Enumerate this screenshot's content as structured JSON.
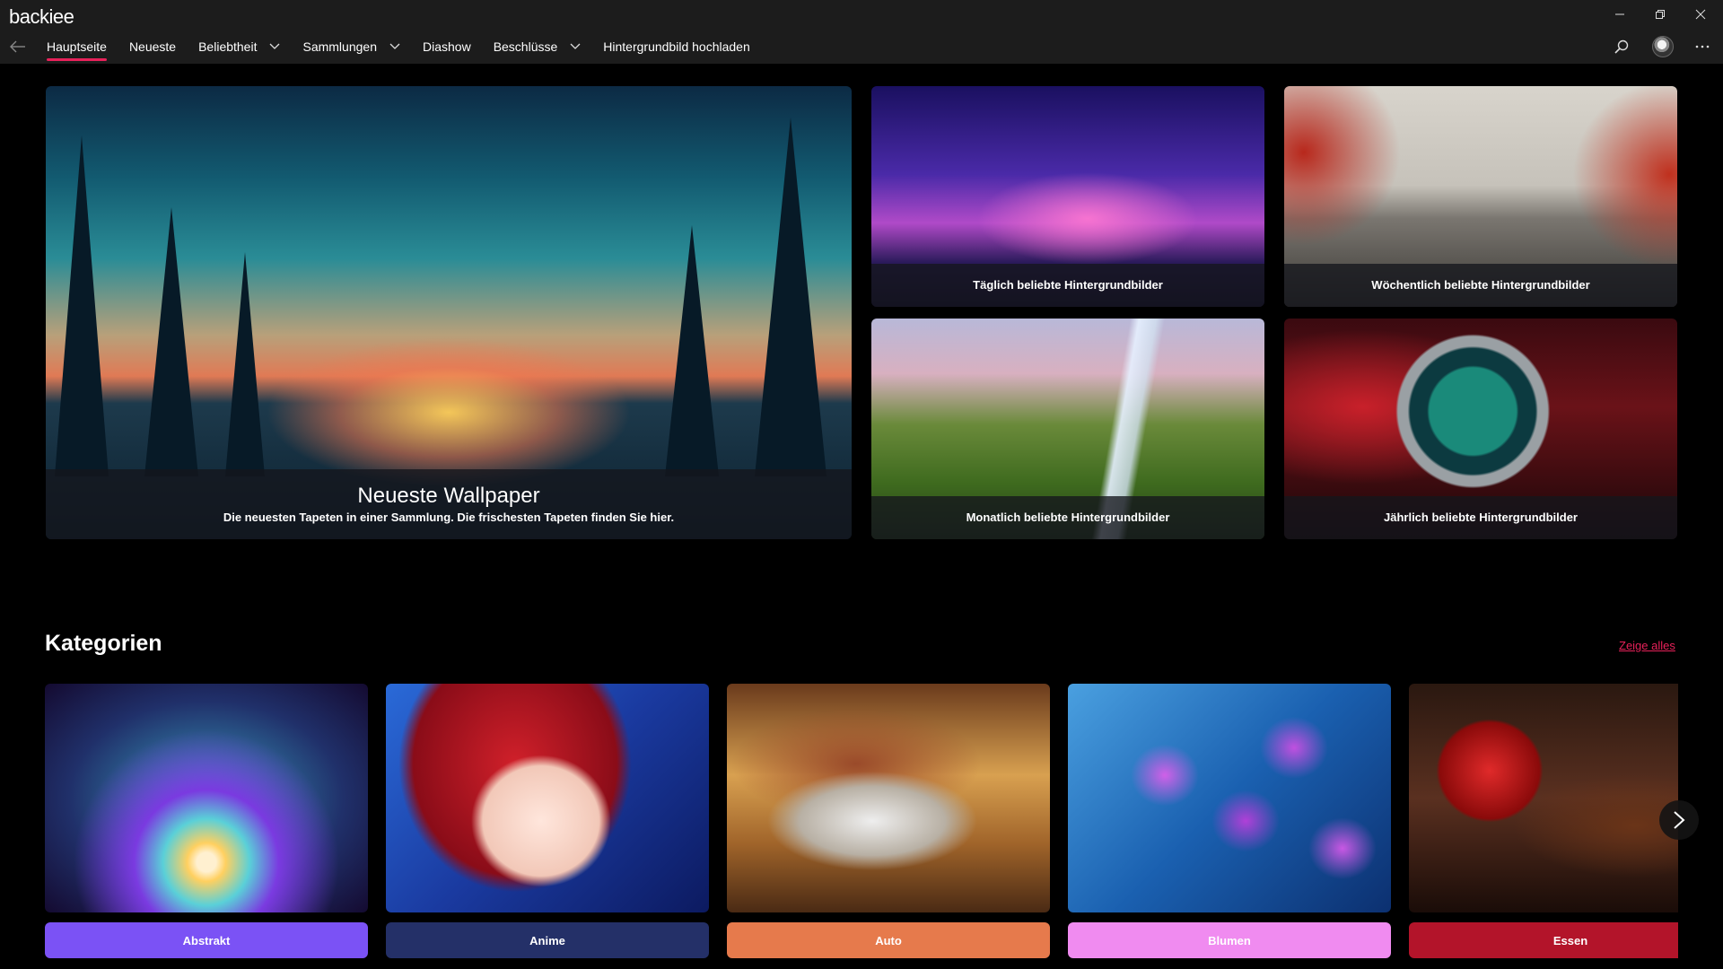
{
  "app": {
    "title": "backiee"
  },
  "nav": {
    "items": [
      {
        "label": "Hauptseite",
        "active": true,
        "dropdown": false
      },
      {
        "label": "Neueste",
        "active": false,
        "dropdown": false
      },
      {
        "label": "Beliebtheit",
        "active": false,
        "dropdown": true
      },
      {
        "label": "Sammlungen",
        "active": false,
        "dropdown": true
      },
      {
        "label": "Diashow",
        "active": false,
        "dropdown": false
      },
      {
        "label": "Beschlüsse",
        "active": false,
        "dropdown": true
      },
      {
        "label": "Hintergrundbild hochladen",
        "active": false,
        "dropdown": false
      }
    ],
    "icons": {
      "back": "back-arrow-icon",
      "search": "search-icon",
      "more": "more-icon"
    }
  },
  "accent_color": "#e8215a",
  "hero": {
    "title": "Neueste Wallpaper",
    "subtitle": "Die neuesten Tapeten in einer Sammlung. Die frischesten Tapeten finden Sie hier."
  },
  "tiles": [
    {
      "label": "Täglich beliebte Hintergrundbilder"
    },
    {
      "label": "Wöchentlich beliebte Hintergrundbilder"
    },
    {
      "label": "Monatlich beliebte Hintergrundbilder"
    },
    {
      "label": "Jährlich beliebte Hintergrundbilder"
    }
  ],
  "categories": {
    "title": "Kategorien",
    "show_all": "Zeige alles",
    "items": [
      {
        "label": "Abstrakt",
        "color": "#7b52f5"
      },
      {
        "label": "Anime",
        "color": "#243068"
      },
      {
        "label": "Auto",
        "color": "#e67a4c"
      },
      {
        "label": "Blumen",
        "color": "#f08bf0"
      },
      {
        "label": "Essen",
        "color": "#b3142a"
      }
    ]
  }
}
